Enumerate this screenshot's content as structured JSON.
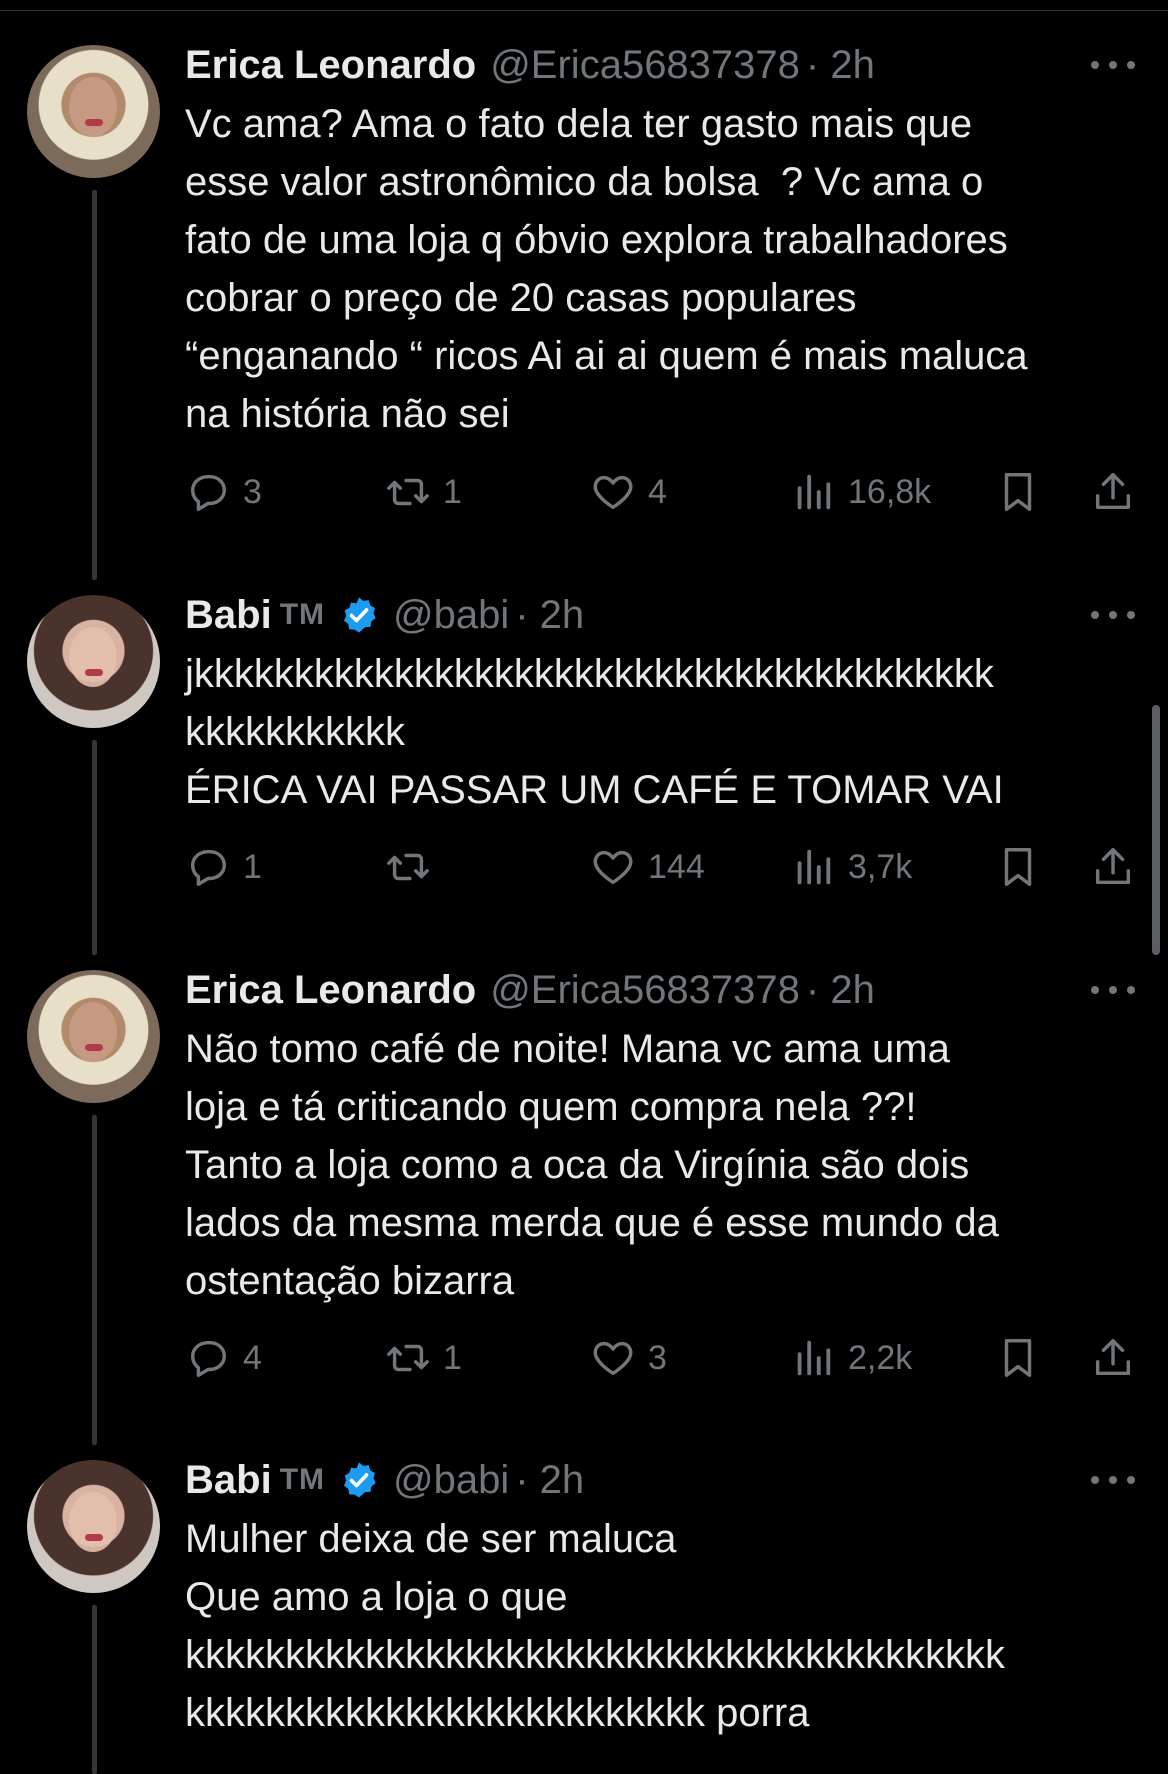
{
  "tweets": [
    {
      "name": "Erica Leonardo",
      "verified": false,
      "handle": "@Erica56837378",
      "time": "· 2h",
      "text": "Vc ama? Ama o fato dela ter gasto mais que\nesse valor astronômico da bolsa  ? Vc ama o\nfato de uma loja q óbvio explora trabalhadores\ncobrar o preço de 20 casas populares\n“enganando “ ricos Ai ai ai quem é mais maluca\nna história não sei",
      "replies": "3",
      "retweets": "1",
      "likes": "4",
      "views": "16,8k"
    },
    {
      "name": "Babi",
      "tm": "TM",
      "verified": true,
      "handle": "@babi",
      "time": "· 2h",
      "text": "jkkkkkkkkkkkkkkkkkkkkkkkkkkkkkkkkkkkkkkkk\nkkkkkkkkkkk\nÉRICA VAI PASSAR UM CAFÉ E TOMAR VAI",
      "replies": "1",
      "retweets": "",
      "likes": "144",
      "views": "3,7k"
    },
    {
      "name": "Erica Leonardo",
      "verified": false,
      "handle": "@Erica56837378",
      "time": "· 2h",
      "text": "Não tomo café de noite! Mana vc ama uma\nloja e tá criticando quem compra nela ??!\nTanto a loja como a oca da Virgínia são dois\nlados da mesma merda que é esse mundo da\nostentação bizarra",
      "replies": "4",
      "retweets": "1",
      "likes": "3",
      "views": "2,2k"
    },
    {
      "name": "Babi",
      "tm": "TM",
      "verified": true,
      "handle": "@babi",
      "time": "· 2h",
      "text": "Mulher deixa de ser maluca\nQue amo a loja o que\nkkkkkkkkkkkkkkkkkkkkkkkkkkkkkkkkkkkkkkkkk\nkkkkkkkkkkkkkkkkkkkkkkkkkk porra"
    }
  ],
  "colors": {
    "background": "#000000",
    "text": "#e7e9ea",
    "muted": "#71767b",
    "verified": "#1d9bf0",
    "thread_line": "#333639"
  },
  "icons": [
    "reply-icon",
    "retweet-icon",
    "like-icon",
    "views-icon",
    "bookmark-icon",
    "share-icon",
    "more-icon",
    "verified-icon"
  ]
}
